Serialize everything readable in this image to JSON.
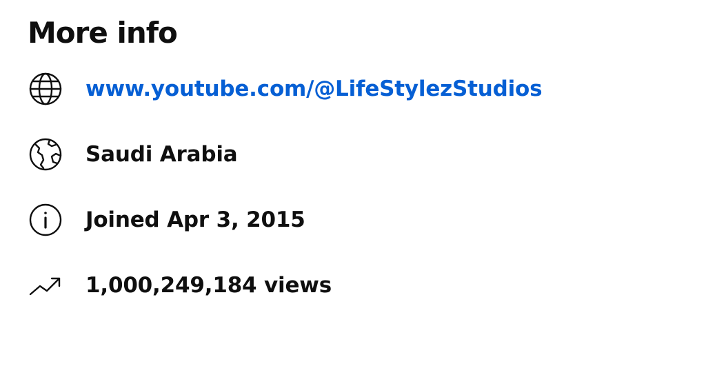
{
  "section": {
    "title": "More info"
  },
  "items": [
    {
      "icon": "globe-icon",
      "text": "www.youtube.com/@LifeStylezStudios",
      "is_link": true
    },
    {
      "icon": "world-map-icon",
      "text": "Saudi Arabia",
      "is_link": false
    },
    {
      "icon": "info-icon",
      "text": "Joined Apr 3, 2015",
      "is_link": false
    },
    {
      "icon": "trending-up-icon",
      "text": "1,000,249,184 views",
      "is_link": false
    }
  ],
  "colors": {
    "link": "#065fd4",
    "text": "#0f0f0f",
    "background": "#ffffff"
  }
}
